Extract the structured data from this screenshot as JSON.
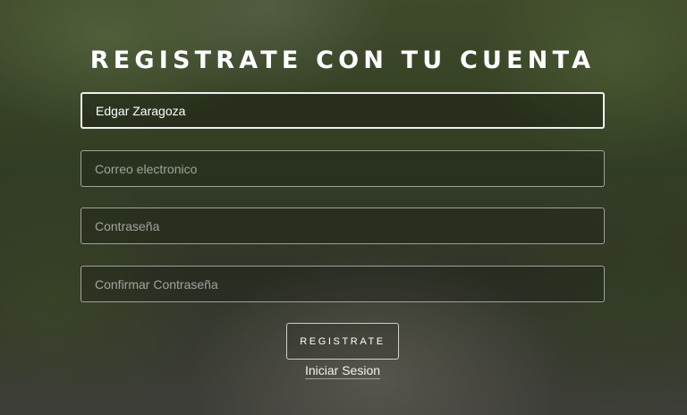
{
  "form": {
    "title": "REGISTRATE CON TU CUENTA",
    "fields": [
      {
        "value": "Edgar Zaragoza",
        "placeholder": ""
      },
      {
        "value": "",
        "placeholder": "Correo electronico"
      },
      {
        "value": "",
        "placeholder": "Contraseña"
      },
      {
        "value": "",
        "placeholder": "Confirmar Contraseña"
      }
    ],
    "submit_label": "REGISTRATE",
    "login_link_label": "Iniciar Sesion"
  }
}
